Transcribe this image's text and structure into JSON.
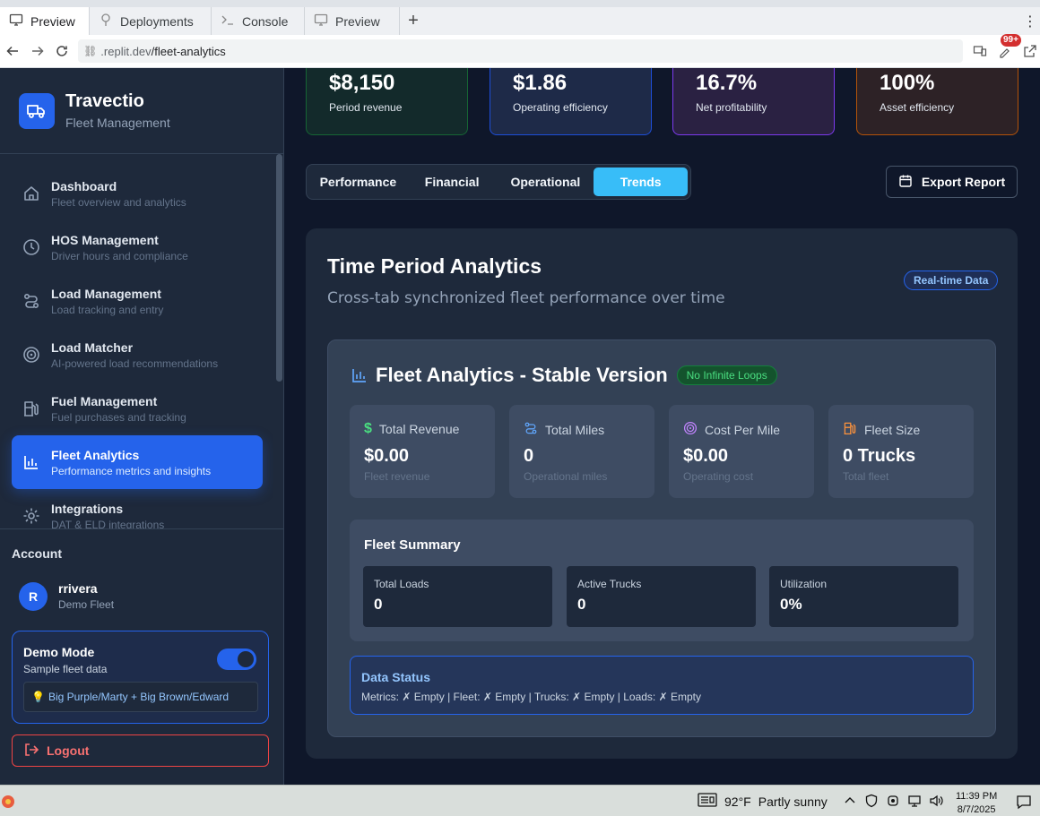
{
  "browser": {
    "tabs": [
      {
        "label": "Preview",
        "active": true
      },
      {
        "label": "Deployments"
      },
      {
        "label": "Console"
      },
      {
        "label": "Preview"
      }
    ],
    "new_tab": "+",
    "url_host": ".replit.dev",
    "url_path": "/fleet-analytics",
    "notification_badge": "99+"
  },
  "sidebar": {
    "brand_title": "Travectio",
    "brand_subtitle": "Fleet Management",
    "items": [
      {
        "label": "Dashboard",
        "desc": "Fleet overview and analytics",
        "icon": "home-icon"
      },
      {
        "label": "HOS Management",
        "desc": "Driver hours and compliance",
        "icon": "clock-icon"
      },
      {
        "label": "Load Management",
        "desc": "Load tracking and entry",
        "icon": "route-icon"
      },
      {
        "label": "Load Matcher",
        "desc": "AI-powered load recommendations",
        "icon": "target-icon"
      },
      {
        "label": "Fuel Management",
        "desc": "Fuel purchases and tracking",
        "icon": "fuel-icon"
      },
      {
        "label": "Fleet Analytics",
        "desc": "Performance metrics and insights",
        "icon": "bar-chart-icon",
        "active": true
      },
      {
        "label": "Integrations",
        "desc": "DAT & ELD integrations",
        "icon": "gear-icon"
      }
    ],
    "account_label": "Account",
    "user_initial": "R",
    "user_name": "rrivera",
    "user_org": "Demo Fleet",
    "demo_title": "Demo Mode",
    "demo_sub": "Sample fleet data",
    "demo_toggle_on": true,
    "demo_note": "Big Purple/Marty + Big Brown/Edward",
    "logout": "Logout"
  },
  "kpis": [
    {
      "value": "$8,150",
      "label": "Period revenue"
    },
    {
      "value": "$1.86",
      "label": "Operating efficiency"
    },
    {
      "value": "16.7%",
      "label": "Net profitability"
    },
    {
      "value": "100%",
      "label": "Asset efficiency"
    }
  ],
  "tabs": [
    "Performance",
    "Financial",
    "Operational",
    "Trends"
  ],
  "active_tab": "Trends",
  "export_label": "Export Report",
  "panel": {
    "title": "Time Period Analytics",
    "subtitle": "Cross-tab synchronized fleet performance over time",
    "badge": "Real-time Data",
    "inner_title": "Fleet Analytics - Stable Version",
    "inner_badge": "No Infinite Loops",
    "stats": [
      {
        "label": "Total Revenue",
        "value": "$0.00",
        "sub": "Fleet revenue",
        "icon": "dollar-icon"
      },
      {
        "label": "Total Miles",
        "value": "0",
        "sub": "Operational miles",
        "icon": "route-icon"
      },
      {
        "label": "Cost Per Mile",
        "value": "$0.00",
        "sub": "Operating cost",
        "icon": "target-icon"
      },
      {
        "label": "Fleet Size",
        "value": "0 Trucks",
        "sub": "Total fleet",
        "icon": "fuel-icon"
      }
    ],
    "summary_title": "Fleet Summary",
    "summary": [
      {
        "label": "Total Loads",
        "value": "0"
      },
      {
        "label": "Active Trucks",
        "value": "0"
      },
      {
        "label": "Utilization",
        "value": "0%"
      }
    ],
    "status_title": "Data Status",
    "status_line": "Metrics: ✗ Empty | Fleet: ✗ Empty | Trucks: ✗ Empty | Loads: ✗ Empty"
  },
  "taskbar": {
    "temp": "92°F",
    "weather": "Partly sunny",
    "time": "11:39 PM",
    "date": "8/7/2025"
  }
}
